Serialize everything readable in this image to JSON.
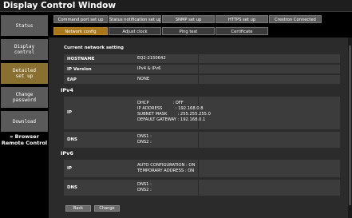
{
  "window": {
    "title": "Display Control Window"
  },
  "sidebar": {
    "items": [
      {
        "label": "Status"
      },
      {
        "label": "Display\ncontrol"
      },
      {
        "label": "Detailed\nset up"
      },
      {
        "label": "Change\npassword"
      },
      {
        "label": "Download"
      }
    ],
    "browser_link": "» Browser\nRemote Control"
  },
  "tabs_top": [
    {
      "label": "Command port set up"
    },
    {
      "label": "Status notification set up"
    },
    {
      "label": "SNMP set up"
    },
    {
      "label": "HTTPS set up"
    },
    {
      "label": "Crestron Connected"
    }
  ],
  "tabs_sub": [
    {
      "label": "Network config"
    },
    {
      "label": "Adjust clock"
    },
    {
      "label": "Ping test"
    },
    {
      "label": "Certificate"
    }
  ],
  "main": {
    "section_title": "Current network setting",
    "rows": [
      {
        "label": "HOSTNAME",
        "value": "EQ2-2150642"
      },
      {
        "label": "IP Version",
        "value": "IPv4 & IPv6"
      },
      {
        "label": "EAP",
        "value": "NONE"
      }
    ],
    "ipv4": {
      "title": "IPv4",
      "ip_label": "IP",
      "ip_value": "DHCP                  : OFF\nIP ADDRESS          : 192.168.0.8\nSUBNET MASK        : 255.255.255.0\nDEFAULT GATEWAY : 192.168.0.1",
      "dns_label": "DNS",
      "dns_value": "DNS1 :\nDNS2 :"
    },
    "ipv6": {
      "title": "IPv6",
      "ip_label": "IP",
      "ip_value": "AUTO CONFIGURATION : ON\nTEMPORARY ADDRESS : ON",
      "dns_label": "DNS",
      "dns_value": "DNS1 :\nDNS2 :"
    },
    "buttons": {
      "back": "Back",
      "change": "Change"
    }
  }
}
